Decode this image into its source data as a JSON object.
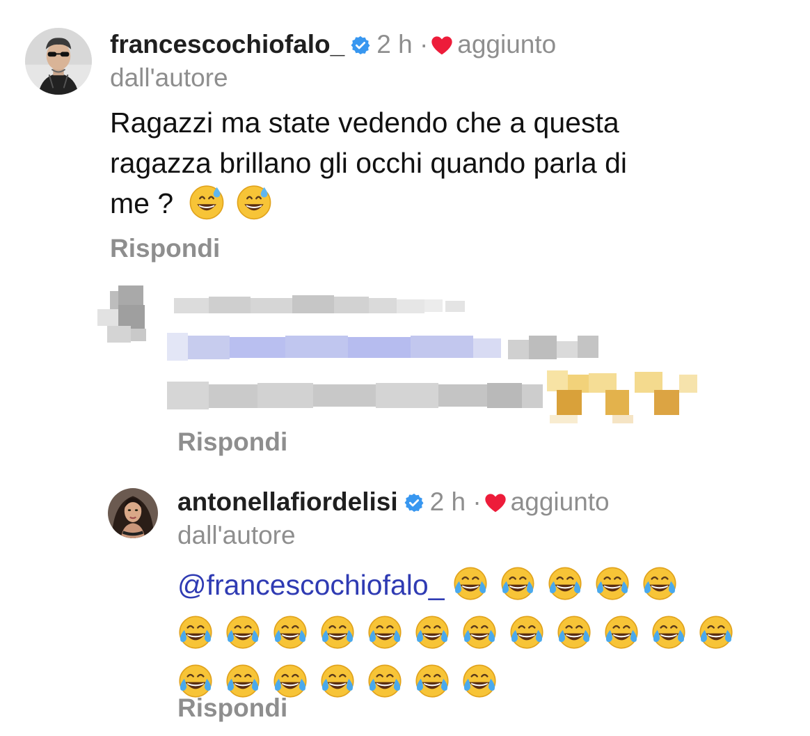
{
  "comment1": {
    "avatar": "avatar-man-sunglasses",
    "username": "francescochiofalo_",
    "time": "2 h",
    "separator": "·",
    "author_like_label_1": "aggiunto",
    "author_like_label_2": "dall'autore",
    "text_line_1": "Ragazzi ma state vedendo che a questa",
    "text_line_2": "ragazza brillano gli occhi quando parla di",
    "text_line_3": "me ?",
    "text_emoji": [
      "grinning-sweat-emoji",
      "grinning-sweat-emoji"
    ],
    "reply_label": "Rispondi"
  },
  "comment2": {
    "pixelated": true,
    "reply_label": "Rispondi"
  },
  "comment3": {
    "avatar": "avatar-woman",
    "username": "antonellafiordelisi",
    "time": "2 h",
    "separator": "·",
    "author_like_label_1": "aggiunto",
    "author_like_label_2": "dall'autore",
    "mention": "@francescochiofalo_",
    "emoji_name": "tears-of-joy-emoji",
    "emoji_row_counts": [
      5,
      12,
      7
    ],
    "reply_label": "Rispondi"
  },
  "colors": {
    "verified": "#3897f0",
    "heart": "#ed1c3a",
    "mention": "#2f3bb3",
    "muted": "#8e8e8e"
  }
}
